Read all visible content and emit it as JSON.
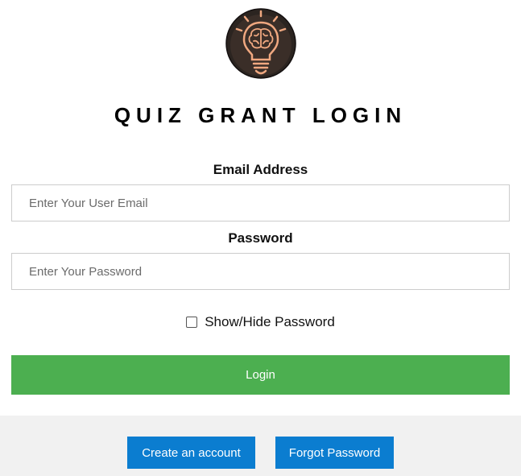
{
  "logo": {
    "icon": "brain-lightbulb-icon",
    "background": "#2b2420",
    "accent": "#f0a880"
  },
  "title": "QUIZ GRANT LOGIN",
  "email": {
    "label": "Email Address",
    "placeholder": "Enter Your User Email",
    "value": ""
  },
  "password": {
    "label": "Password",
    "placeholder": "Enter Your Password",
    "value": ""
  },
  "show_password": {
    "label": "Show/Hide Password",
    "checked": false
  },
  "login_button": {
    "label": "Login",
    "color": "#4caf50"
  },
  "footer": {
    "create_account_label": "Create an account",
    "forgot_password_label": "Forgot Password",
    "button_color": "#0b7dd0",
    "background": "#f1f1f1"
  }
}
